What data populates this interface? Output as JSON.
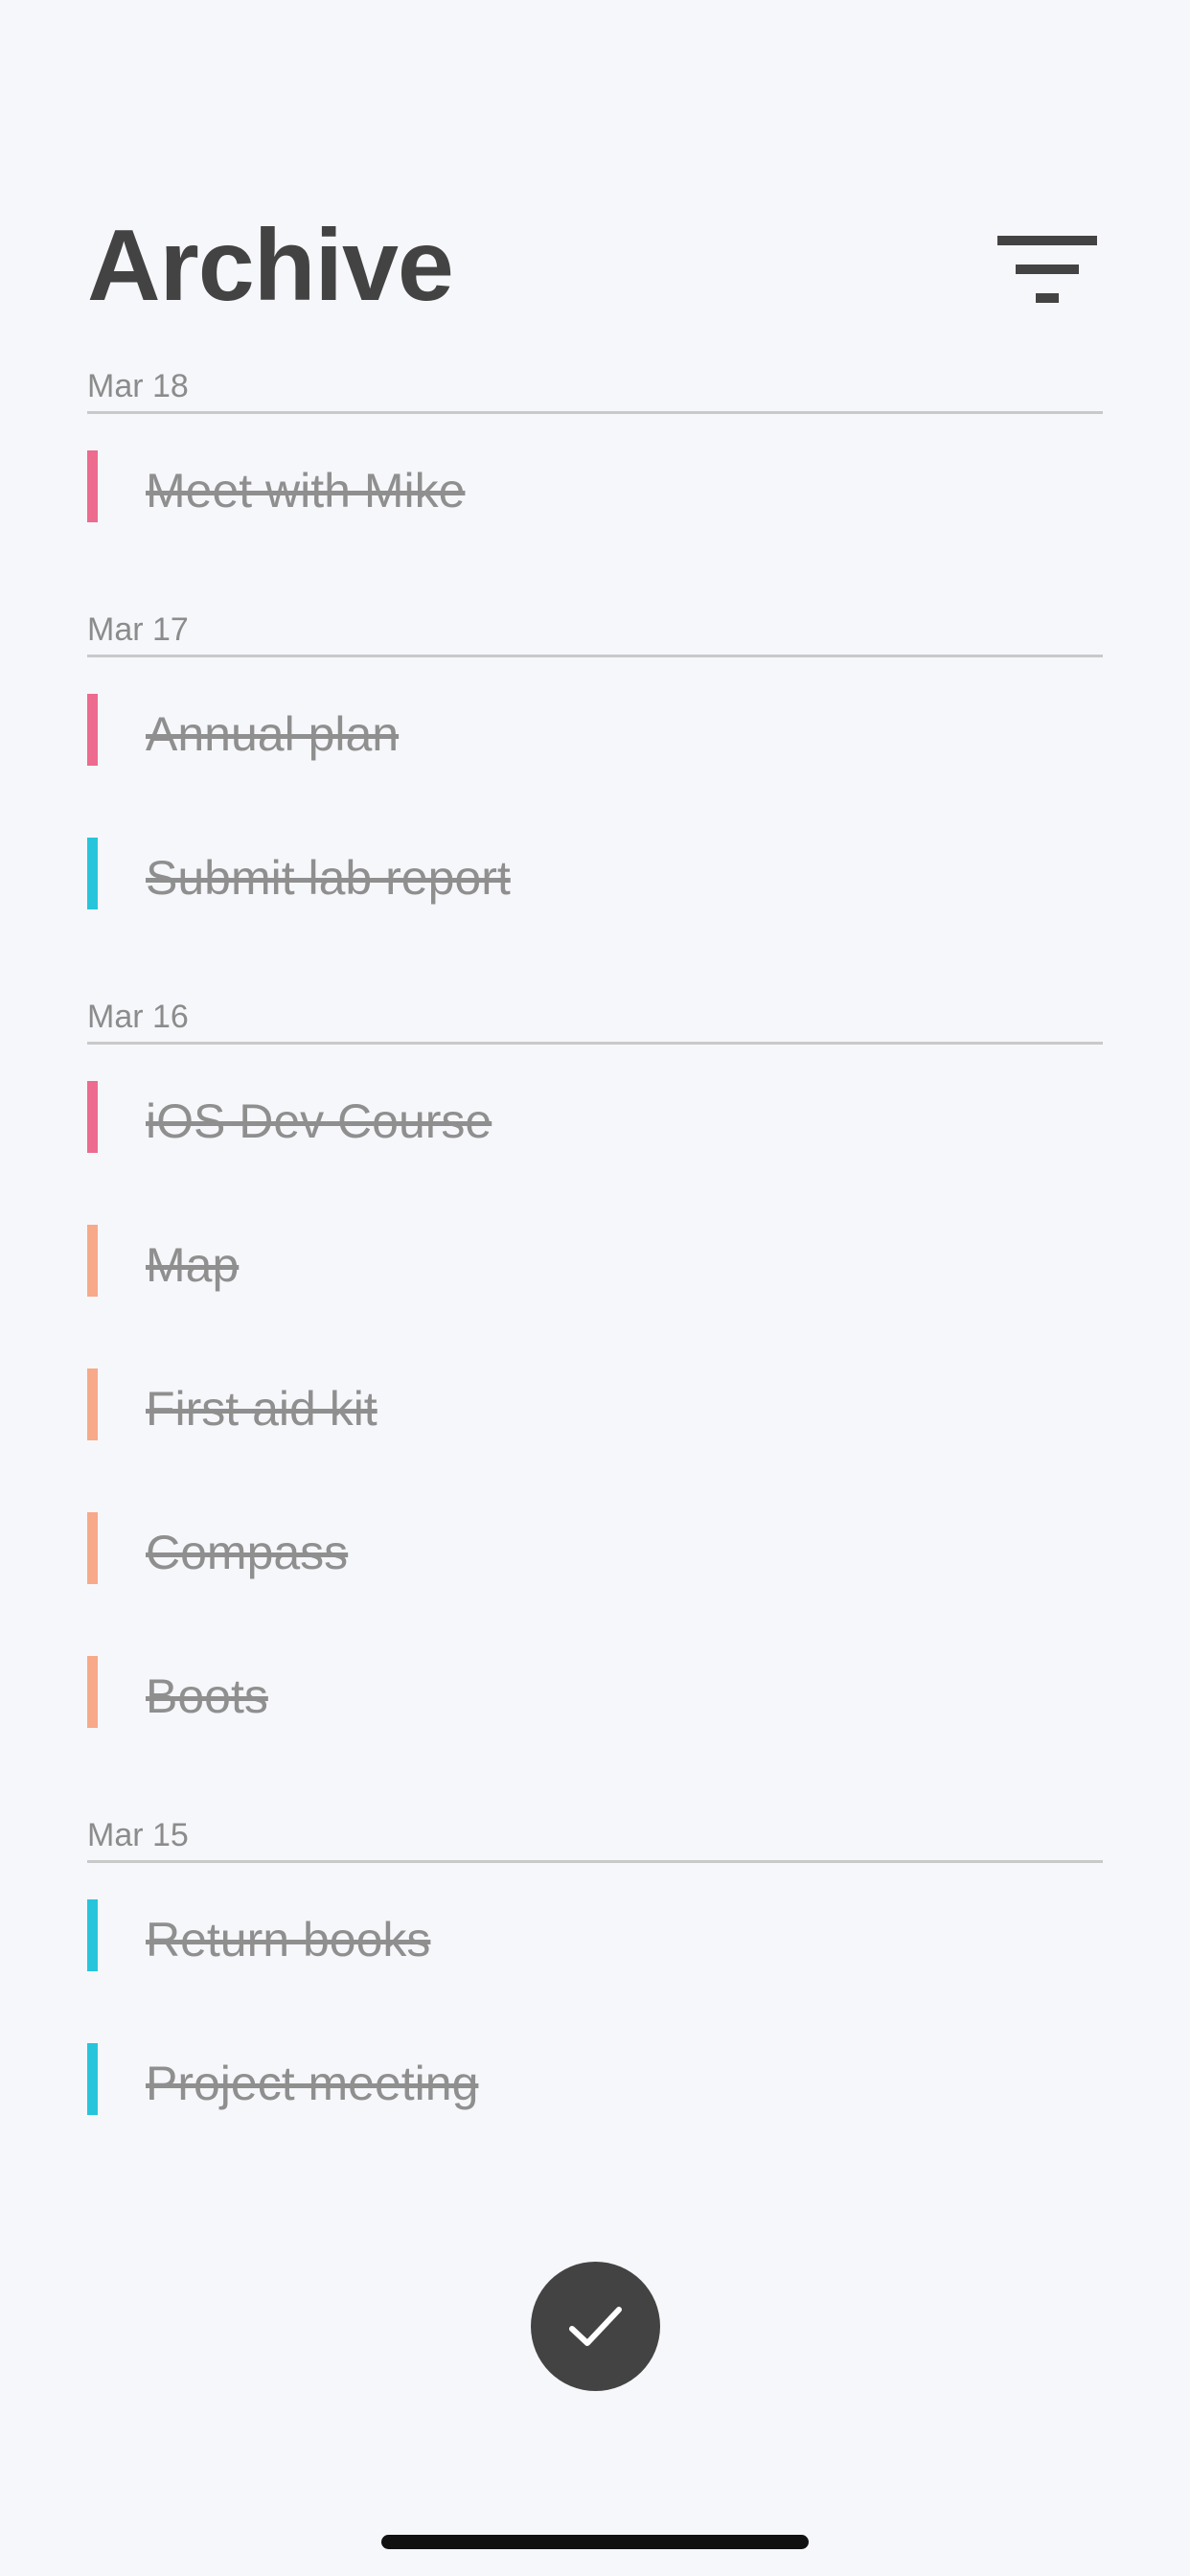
{
  "header": {
    "title": "Archive",
    "filter_icon": "filter-icon"
  },
  "colors": {
    "background": "#f6f7fa",
    "text_dark": "#434343",
    "text_muted": "#8f8f8f",
    "pink": "#ec6b8e",
    "cyan": "#27c5dc",
    "peach": "#f7a98a"
  },
  "groups": [
    {
      "date": "Mar 18",
      "tasks": [
        {
          "label": "Meet with Mike",
          "color": "#ec6b8e"
        }
      ]
    },
    {
      "date": "Mar 17",
      "tasks": [
        {
          "label": "Annual plan",
          "color": "#ec6b8e"
        },
        {
          "label": "Submit lab report",
          "color": "#27c5dc"
        }
      ]
    },
    {
      "date": "Mar 16",
      "tasks": [
        {
          "label": "iOS Dev Course",
          "color": "#ec6b8e"
        },
        {
          "label": "Map",
          "color": "#f7a98a"
        },
        {
          "label": "First aid kit",
          "color": "#f7a98a"
        },
        {
          "label": "Compass",
          "color": "#f7a98a"
        },
        {
          "label": "Boots",
          "color": "#f7a98a"
        }
      ]
    },
    {
      "date": "Mar 15",
      "tasks": [
        {
          "label": "Return books",
          "color": "#27c5dc"
        },
        {
          "label": "Project meeting",
          "color": "#27c5dc"
        }
      ]
    }
  ],
  "fab": {
    "icon": "checkmark-icon"
  }
}
